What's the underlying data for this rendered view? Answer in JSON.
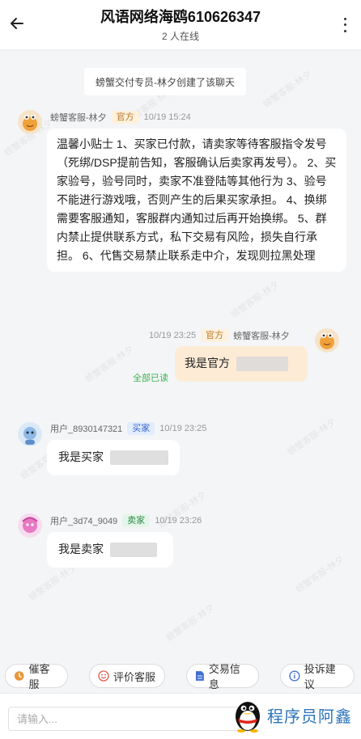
{
  "header": {
    "title": "风语网络海鸥610626347",
    "subtitle": "2 人在线"
  },
  "watermark": "螃蟹客服-林夕",
  "system_message": "螃蟹交付专员-林夕创建了该聊天",
  "messages": [
    {
      "sender": "螃蟹客服-林夕",
      "badge": "官方",
      "time": "10/19 15:24",
      "text": "温馨小贴士 1、买家已付款，请卖家等待客服指令发号（死绑/DSP提前告知，客服确认后卖家再发号）。 2、买家验号，验号同时，卖家不准登陆等其他行为 3、验号不能进行游戏哦，否则产生的后果买家承担。 4、换绑需要客服通知，客服群内通知过后再开始换绑。 5、群内禁止提供联系方式，私下交易有风险，损失自行承担。 6、代售交易禁止联系走中介，发现则拉黑处理"
    },
    {
      "sender": "螃蟹客服-林夕",
      "badge": "官方",
      "time": "10/19 23:25",
      "text": "我是官方",
      "status": "全部已读"
    },
    {
      "sender": "用户_8930147321",
      "badge": "买家",
      "time": "10/19 23:25",
      "text": "我是买家"
    },
    {
      "sender": "用户_3d74_9049",
      "badge": "卖家",
      "time": "10/19 23:26",
      "text": "我是卖家"
    }
  ],
  "quick_actions": [
    "催客服",
    "评价客服",
    "交易信息",
    "投诉建议"
  ],
  "input": {
    "placeholder": "请输入..."
  },
  "brand": "程序员阿鑫",
  "colors": {
    "accent_orange": "#e8953a",
    "read_green": "#3bb24f",
    "bubble_orange": "#fdebd5",
    "brand_blue": "#2a73b9"
  },
  "icons": {
    "back": "arrow-left-icon",
    "more": "more-vertical-icon",
    "urge": "clock-icon",
    "rate": "smile-icon",
    "trade": "document-icon",
    "complain": "info-icon"
  }
}
